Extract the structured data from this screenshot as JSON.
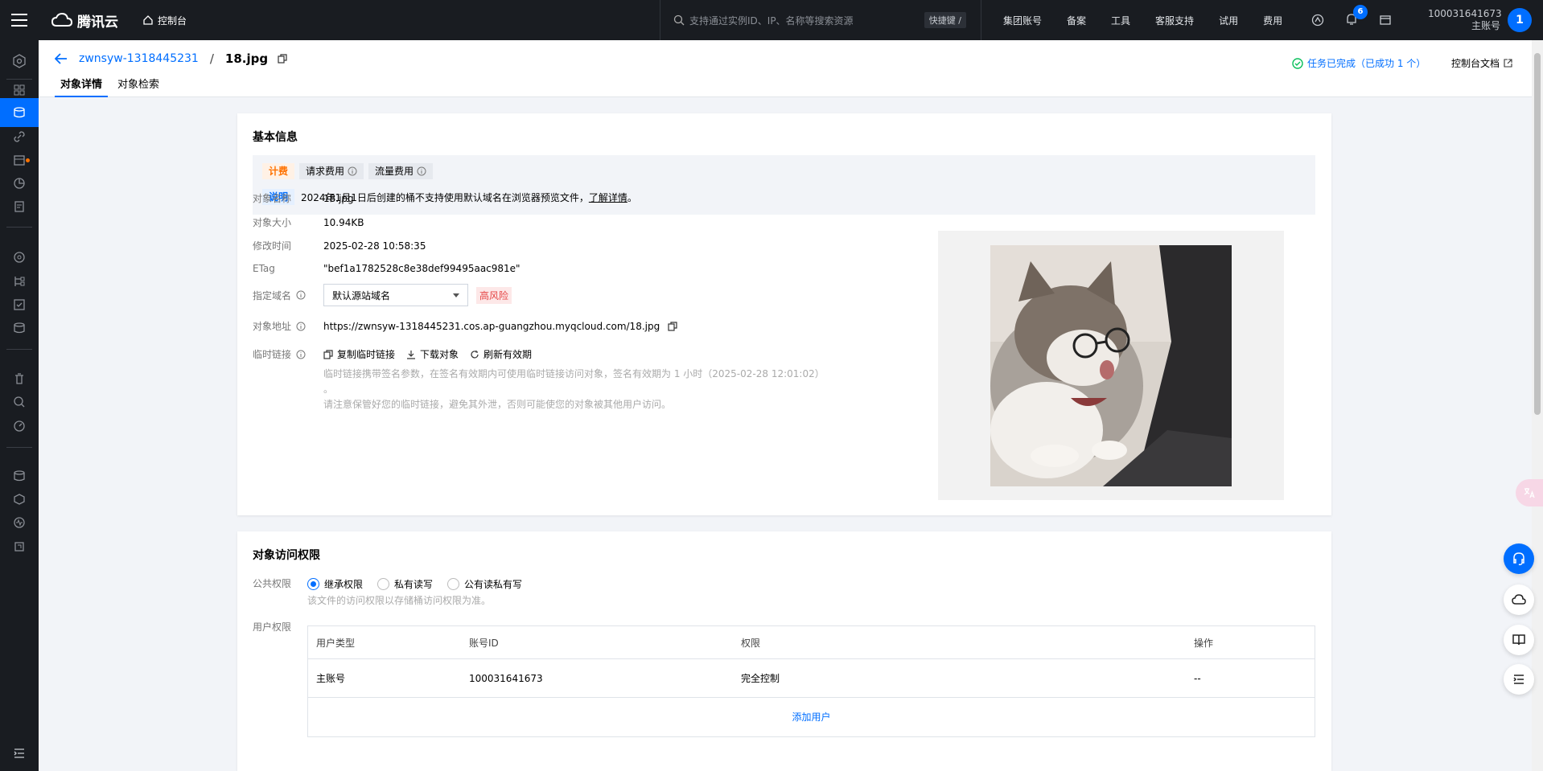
{
  "topbar": {
    "brand": "腾讯云",
    "console": "控制台",
    "search_placeholder": "支持通过实例ID、IP、名称等搜索资源",
    "shortcut": "快捷键 /",
    "nav": [
      "集团账号",
      "备案",
      "工具",
      "客服支持",
      "试用",
      "费用"
    ],
    "notification_count": "6",
    "account_id": "100031641673",
    "account_role": "主账号",
    "avatar_letter": "1"
  },
  "header": {
    "bucket": "zwnsyw-1318445231",
    "separator": "/",
    "file": "18.jpg",
    "tabs": [
      "对象详情",
      "对象检索"
    ],
    "task_status": "任务已完成（已成功 1 个）",
    "doc_link": "控制台文档"
  },
  "basic": {
    "title": "基本信息",
    "tags": {
      "billing": "计费",
      "request_fee": "请求费用",
      "traffic_fee": "流量费用",
      "note": "说明"
    },
    "notice_text": "2024年1月1日后创建的桶不支持使用默认域名在浏览器预览文件，",
    "notice_link": "了解详情",
    "notice_end": "。",
    "fields": {
      "name_label": "对象名称",
      "name_value": "18.jpg",
      "size_label": "对象大小",
      "size_value": "10.94KB",
      "mtime_label": "修改时间",
      "mtime_value": "2025-02-28 10:58:35",
      "etag_label": "ETag",
      "etag_value": "\"bef1a1782528c8e38def99495aac981e\"",
      "domain_label": "指定域名",
      "domain_value": "默认源站域名",
      "risk": "高风险",
      "url_label": "对象地址",
      "url_value": "https://zwnsyw-1318445231.cos.ap-guangzhou.myqcloud.com/18.jpg",
      "temp_label": "临时链接",
      "copy_temp": "复制临时链接",
      "download": "下载对象",
      "refresh": "刷新有效期",
      "temp_hint1": "临时链接携带签名参数，在签名有效期内可使用临时链接访问对象，签名有效期为 1 小时（2025-02-28 12:01:02）",
      "temp_hint2": "。",
      "temp_hint3": "请注意保管好您的临时链接，避免其外泄，否则可能使您的对象被其他用户访问。"
    }
  },
  "permission": {
    "title": "对象访问权限",
    "public_label": "公共权限",
    "options": [
      "继承权限",
      "私有读写",
      "公有读私有写"
    ],
    "public_hint": "该文件的访问权限以存储桶访问权限为准。",
    "user_label": "用户权限",
    "columns": [
      "用户类型",
      "账号ID",
      "权限",
      "操作"
    ],
    "rows": [
      [
        "主账号",
        "100031641673",
        "完全控制",
        "--"
      ]
    ],
    "add_user": "添加用户"
  },
  "colors": {
    "accent": "#006eff",
    "topbar": "#191c21",
    "success": "#0abf5b",
    "danger": "#e54545"
  }
}
